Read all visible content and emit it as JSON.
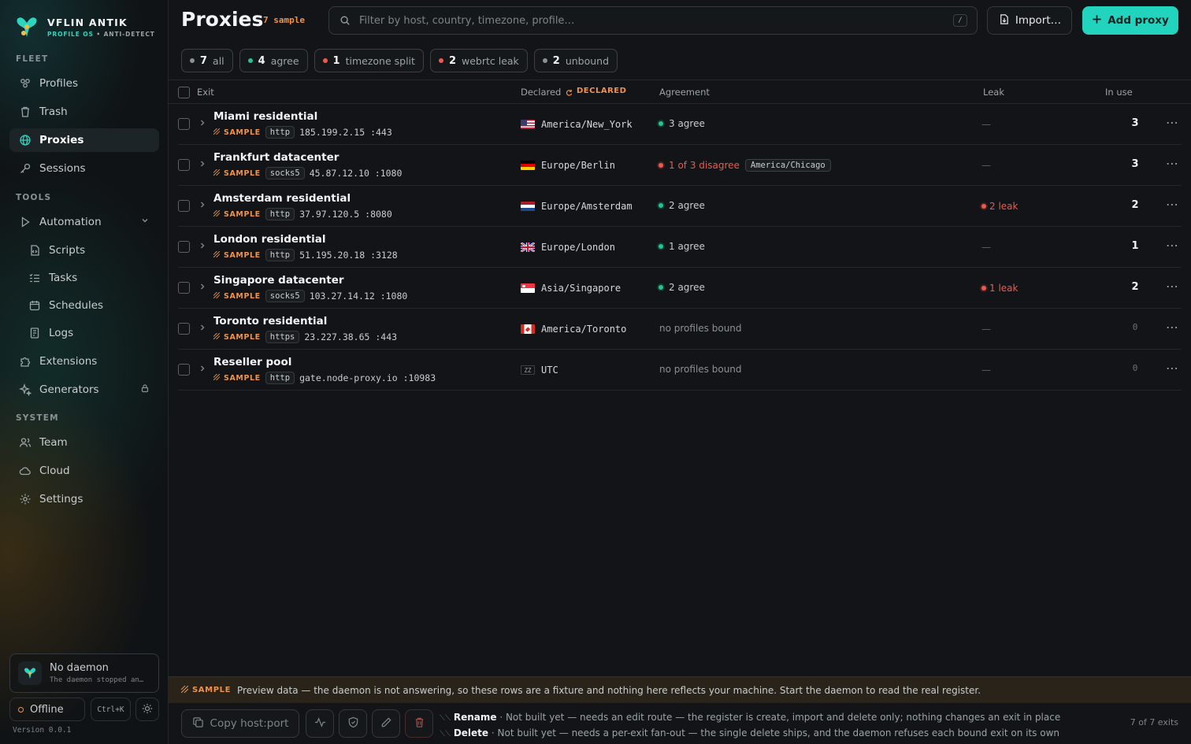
{
  "brand": {
    "name": "VFLIN ANTIK",
    "sub_a": "PROFILE OS",
    "sub_sep": " • ",
    "sub_b": "ANTI-DETECT"
  },
  "sidebar": {
    "sections": {
      "fleet": "FLEET",
      "tools": "TOOLS",
      "system": "SYSTEM"
    },
    "items": {
      "profiles": "Profiles",
      "trash": "Trash",
      "proxies": "Proxies",
      "sessions": "Sessions",
      "automation": "Automation",
      "scripts": "Scripts",
      "tasks": "Tasks",
      "schedules": "Schedules",
      "logs": "Logs",
      "extensions": "Extensions",
      "generators": "Generators",
      "team": "Team",
      "cloud": "Cloud",
      "settings": "Settings"
    },
    "active": "proxies",
    "daemon": {
      "title": "No daemon",
      "sub": "The daemon stopped an…"
    },
    "status": "Offline",
    "shortcut": "Ctrl+K",
    "version": "Version 0.0.1"
  },
  "header": {
    "title": "Proxies",
    "tag": "7 sample",
    "search_placeholder": "Filter by host, country, timezone, profile…",
    "search_kbd": "/",
    "import_label": "Import…",
    "add_label": "Add proxy"
  },
  "filters": [
    {
      "count": "7",
      "label": "all",
      "color": "#8a9196"
    },
    {
      "count": "4",
      "label": "agree",
      "color": "#22c58b"
    },
    {
      "count": "1",
      "label": "timezone split",
      "color": "#f0584d"
    },
    {
      "count": "2",
      "label": "webrtc leak",
      "color": "#f0584d"
    },
    {
      "count": "2",
      "label": "unbound",
      "color": "#8a9196"
    }
  ],
  "columns": {
    "exit": "Exit",
    "declared": "Declared",
    "declared_tag": "DECLARED",
    "agreement": "Agreement",
    "leak": "Leak",
    "in_use": "In use"
  },
  "rows": [
    {
      "name": "Miami residential",
      "sample": "SAMPLE",
      "proto": "http",
      "addr": "185.199.2.15 :443",
      "flag": "us",
      "tz": "America/New_York",
      "agreement": "3 agree",
      "agree_state": "ok",
      "tz_chip": "",
      "leak": "—",
      "leak_hot": false,
      "in_use": "3"
    },
    {
      "name": "Frankfurt datacenter",
      "sample": "SAMPLE",
      "proto": "socks5",
      "addr": "45.87.12.10 :1080",
      "flag": "de",
      "tz": "Europe/Berlin",
      "agreement": "1 of 3 disagree",
      "agree_state": "bad",
      "tz_chip": "America/Chicago",
      "leak": "—",
      "leak_hot": false,
      "in_use": "3"
    },
    {
      "name": "Amsterdam residential",
      "sample": "SAMPLE",
      "proto": "http",
      "addr": "37.97.120.5 :8080",
      "flag": "nl",
      "tz": "Europe/Amsterdam",
      "agreement": "2 agree",
      "agree_state": "ok",
      "tz_chip": "",
      "leak": "2 leak",
      "leak_hot": true,
      "in_use": "2"
    },
    {
      "name": "London residential",
      "sample": "SAMPLE",
      "proto": "http",
      "addr": "51.195.20.18 :3128",
      "flag": "gb",
      "tz": "Europe/London",
      "agreement": "1 agree",
      "agree_state": "ok",
      "tz_chip": "",
      "leak": "—",
      "leak_hot": false,
      "in_use": "1"
    },
    {
      "name": "Singapore datacenter",
      "sample": "SAMPLE",
      "proto": "socks5",
      "addr": "103.27.14.12 :1080",
      "flag": "sg",
      "tz": "Asia/Singapore",
      "agreement": "2 agree",
      "agree_state": "ok",
      "tz_chip": "",
      "leak": "1 leak",
      "leak_hot": true,
      "in_use": "2"
    },
    {
      "name": "Toronto residential",
      "sample": "SAMPLE",
      "proto": "https",
      "addr": "23.227.38.65 :443",
      "flag": "ca",
      "tz": "America/Toronto",
      "agreement": "no profiles bound",
      "agree_state": "none",
      "tz_chip": "",
      "leak": "—",
      "leak_hot": false,
      "in_use": "0"
    },
    {
      "name": "Reseller pool",
      "sample": "SAMPLE",
      "proto": "http",
      "addr": "gate.node-proxy.io :10983",
      "flag": "zz",
      "flag_text": "ZZ",
      "tz": "UTC",
      "agreement": "no profiles bound",
      "agree_state": "none",
      "tz_chip": "",
      "leak": "—",
      "leak_hot": false,
      "in_use": "0"
    }
  ],
  "banner": {
    "tag": "SAMPLE",
    "text": "Preview data — the daemon is not answering, so these rows are a fixture and nothing here reflects your machine. Start the daemon to read the real register."
  },
  "footer": {
    "copy_label": "Copy host:port",
    "notes": [
      {
        "title": "Rename",
        "text": " · Not built yet — needs an edit route — the register is create, import and delete only; nothing changes an exit in place"
      },
      {
        "title": "Delete",
        "text": " · Not built yet — needs a per-exit fan-out — the single delete ships, and the daemon refuses each bound exit on its own"
      }
    ],
    "count": "7 of 7 exits"
  },
  "colors": {
    "accent": "#22d3bd",
    "sample": "#f0924a",
    "ok": "#22c58b",
    "bad": "#f0584d"
  }
}
